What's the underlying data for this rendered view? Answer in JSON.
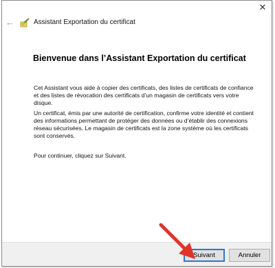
{
  "window": {
    "title": "Assistant Exportation du certificat",
    "close_glyph": "✕",
    "back_glyph": "←"
  },
  "page": {
    "heading": "Bienvenue dans l’Assistant Exportation du certificat",
    "paragraph1": "Cet Assistant vous aide à copier des certificats, des listes de certificats de confiance et des listes de révocation des certificats d’un magasin de certificats vers votre disque.",
    "paragraph2": "Un certificat, émis par une autorité de certification, confirme votre identité et contient des informations permettant de protéger des données ou d’établir des connexions réseau sécurisées. Le magasin de certificats est la zone système où les certificats sont conservés.",
    "paragraph3": "Pour continuer, cliquez sur Suivant."
  },
  "buttons": {
    "next_label": "Suivant",
    "cancel_label": "Annuler"
  },
  "icons": {
    "wizard": "certificate-wizard-icon",
    "back": "back-arrow-icon",
    "close": "close-icon",
    "annotation": "red-arrow-annotation"
  },
  "colors": {
    "default_button_border": "#2b74d6",
    "annotation_arrow": "#e0342b",
    "footer_background": "#f0f0f0"
  }
}
